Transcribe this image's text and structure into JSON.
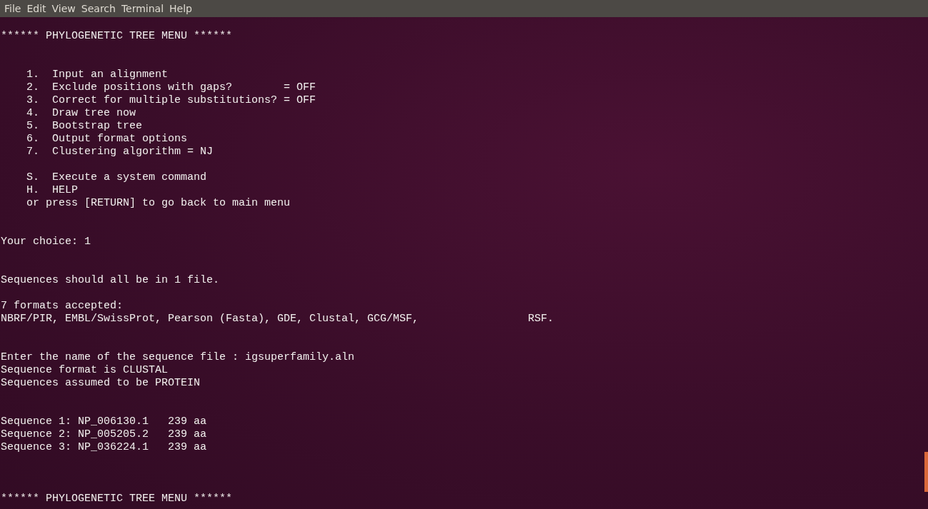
{
  "menu_bar": [
    "File",
    "Edit",
    "View",
    "Search",
    "Terminal",
    "Help"
  ],
  "terminal": {
    "lines": [
      {
        "kind": "blank"
      },
      {
        "kind": "text",
        "text": "****** PHYLOGENETIC TREE MENU ******"
      },
      {
        "kind": "blank"
      },
      {
        "kind": "blank"
      },
      {
        "kind": "menu_item",
        "text": "1.  Input an alignment"
      },
      {
        "kind": "menu_item",
        "text": "2.  Exclude positions with gaps?        = OFF"
      },
      {
        "kind": "menu_item",
        "text": "3.  Correct for multiple substitutions? = OFF"
      },
      {
        "kind": "menu_item",
        "text": "4.  Draw tree now"
      },
      {
        "kind": "menu_item",
        "text": "5.  Bootstrap tree"
      },
      {
        "kind": "menu_item",
        "text": "6.  Output format options"
      },
      {
        "kind": "menu_item",
        "text": "7.  Clustering algorithm = NJ"
      },
      {
        "kind": "blank"
      },
      {
        "kind": "menu_item",
        "text": "S.  Execute a system command"
      },
      {
        "kind": "menu_item",
        "text": "H.  HELP"
      },
      {
        "kind": "menu_item",
        "text": "or press [RETURN] to go back to main menu"
      },
      {
        "kind": "blank"
      },
      {
        "kind": "blank"
      },
      {
        "kind": "text",
        "text": "Your choice: 1"
      },
      {
        "kind": "blank"
      },
      {
        "kind": "blank"
      },
      {
        "kind": "text",
        "text": "Sequences should all be in 1 file."
      },
      {
        "kind": "blank"
      },
      {
        "kind": "text",
        "text": "7 formats accepted:"
      },
      {
        "kind": "text",
        "text": "NBRF/PIR, EMBL/SwissProt, Pearson (Fasta), GDE, Clustal, GCG/MSF,                 RSF."
      },
      {
        "kind": "blank"
      },
      {
        "kind": "blank"
      },
      {
        "kind": "text",
        "text": "Enter the name of the sequence file : igsuperfamily.aln"
      },
      {
        "kind": "text",
        "text": "Sequence format is CLUSTAL"
      },
      {
        "kind": "text",
        "text": "Sequences assumed to be PROTEIN"
      },
      {
        "kind": "blank"
      },
      {
        "kind": "blank"
      },
      {
        "kind": "text",
        "text": "Sequence 1: NP_006130.1   239 aa"
      },
      {
        "kind": "text",
        "text": "Sequence 2: NP_005205.2   239 aa"
      },
      {
        "kind": "text",
        "text": "Sequence 3: NP_036224.1   239 aa"
      },
      {
        "kind": "blank"
      },
      {
        "kind": "blank"
      },
      {
        "kind": "blank"
      },
      {
        "kind": "text",
        "text": "****** PHYLOGENETIC TREE MENU ******"
      }
    ]
  }
}
